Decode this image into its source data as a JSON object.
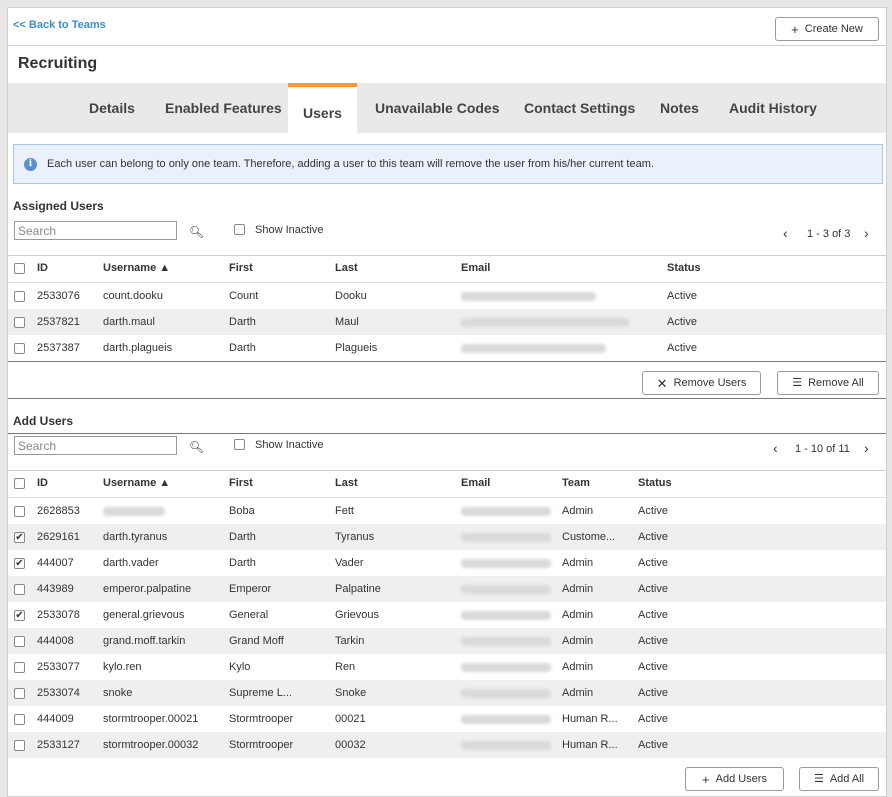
{
  "nav": {
    "back_label": "<< Back to Teams",
    "create_label": "Create New"
  },
  "page_title": "Recruiting",
  "tabs": [
    "Details",
    "Enabled Features",
    "Users",
    "Unavailable Codes",
    "Contact Settings",
    "Notes",
    "Audit History"
  ],
  "active_tab": "Users",
  "info_text": "Each user can belong to only one team. Therefore, adding a user to this team will remove the user from his/her current team.",
  "assigned": {
    "heading": "Assigned Users",
    "search_placeholder": "Search",
    "show_inactive": "Show Inactive",
    "pager": "1 - 3 of 3",
    "columns": [
      "ID",
      "Username ▲",
      "First",
      "Last",
      "Email",
      "Status"
    ],
    "rows": [
      {
        "id": "2533076",
        "username": "count.dooku",
        "first": "Count",
        "last": "Dooku",
        "status": "Active"
      },
      {
        "id": "2537821",
        "username": "darth.maul",
        "first": "Darth",
        "last": "Maul",
        "status": "Active"
      },
      {
        "id": "2537387",
        "username": "darth.plagueis",
        "first": "Darth",
        "last": "Plagueis",
        "status": "Active"
      }
    ],
    "remove_label": "Remove Users",
    "remove_all_label": "Remove All"
  },
  "add": {
    "heading": "Add Users",
    "search_placeholder": "Search",
    "show_inactive": "Show Inactive",
    "pager": "1 - 10 of 11",
    "columns": [
      "ID",
      "Username ▲",
      "First",
      "Last",
      "Email",
      "Team",
      "Status"
    ],
    "rows": [
      {
        "id": "2628853",
        "username": "",
        "first": "Boba",
        "last": "Fett",
        "team": "Admin",
        "status": "Active",
        "checked": false
      },
      {
        "id": "2629161",
        "username": "darth.tyranus",
        "first": "Darth",
        "last": "Tyranus",
        "team": "Custome...",
        "status": "Active",
        "checked": true
      },
      {
        "id": "444007",
        "username": "darth.vader",
        "first": "Darth",
        "last": "Vader",
        "team": "Admin",
        "status": "Active",
        "checked": true
      },
      {
        "id": "443989",
        "username": "emperor.palpatine",
        "first": "Emperor",
        "last": "Palpatine",
        "team": "Admin",
        "status": "Active",
        "checked": false
      },
      {
        "id": "2533078",
        "username": "general.grievous",
        "first": "General",
        "last": "Grievous",
        "team": "Admin",
        "status": "Active",
        "checked": true
      },
      {
        "id": "444008",
        "username": "grand.moff.tarkin",
        "first": "Grand Moff",
        "last": "Tarkin",
        "team": "Admin",
        "status": "Active",
        "checked": false
      },
      {
        "id": "2533077",
        "username": "kylo.ren",
        "first": "Kylo",
        "last": "Ren",
        "team": "Admin",
        "status": "Active",
        "checked": false
      },
      {
        "id": "2533074",
        "username": "snoke",
        "first": "Supreme L...",
        "last": "Snoke",
        "team": "Admin",
        "status": "Active",
        "checked": false
      },
      {
        "id": "444009",
        "username": "stormtrooper.00021",
        "first": "Stormtrooper",
        "last": "00021",
        "team": "Human R...",
        "status": "Active",
        "checked": false
      },
      {
        "id": "2533127",
        "username": "stormtrooper.00032",
        "first": "Stormtrooper",
        "last": "00032",
        "team": "Human R...",
        "status": "Active",
        "checked": false
      }
    ],
    "add_label": "Add Users",
    "add_all_label": "Add All"
  }
}
